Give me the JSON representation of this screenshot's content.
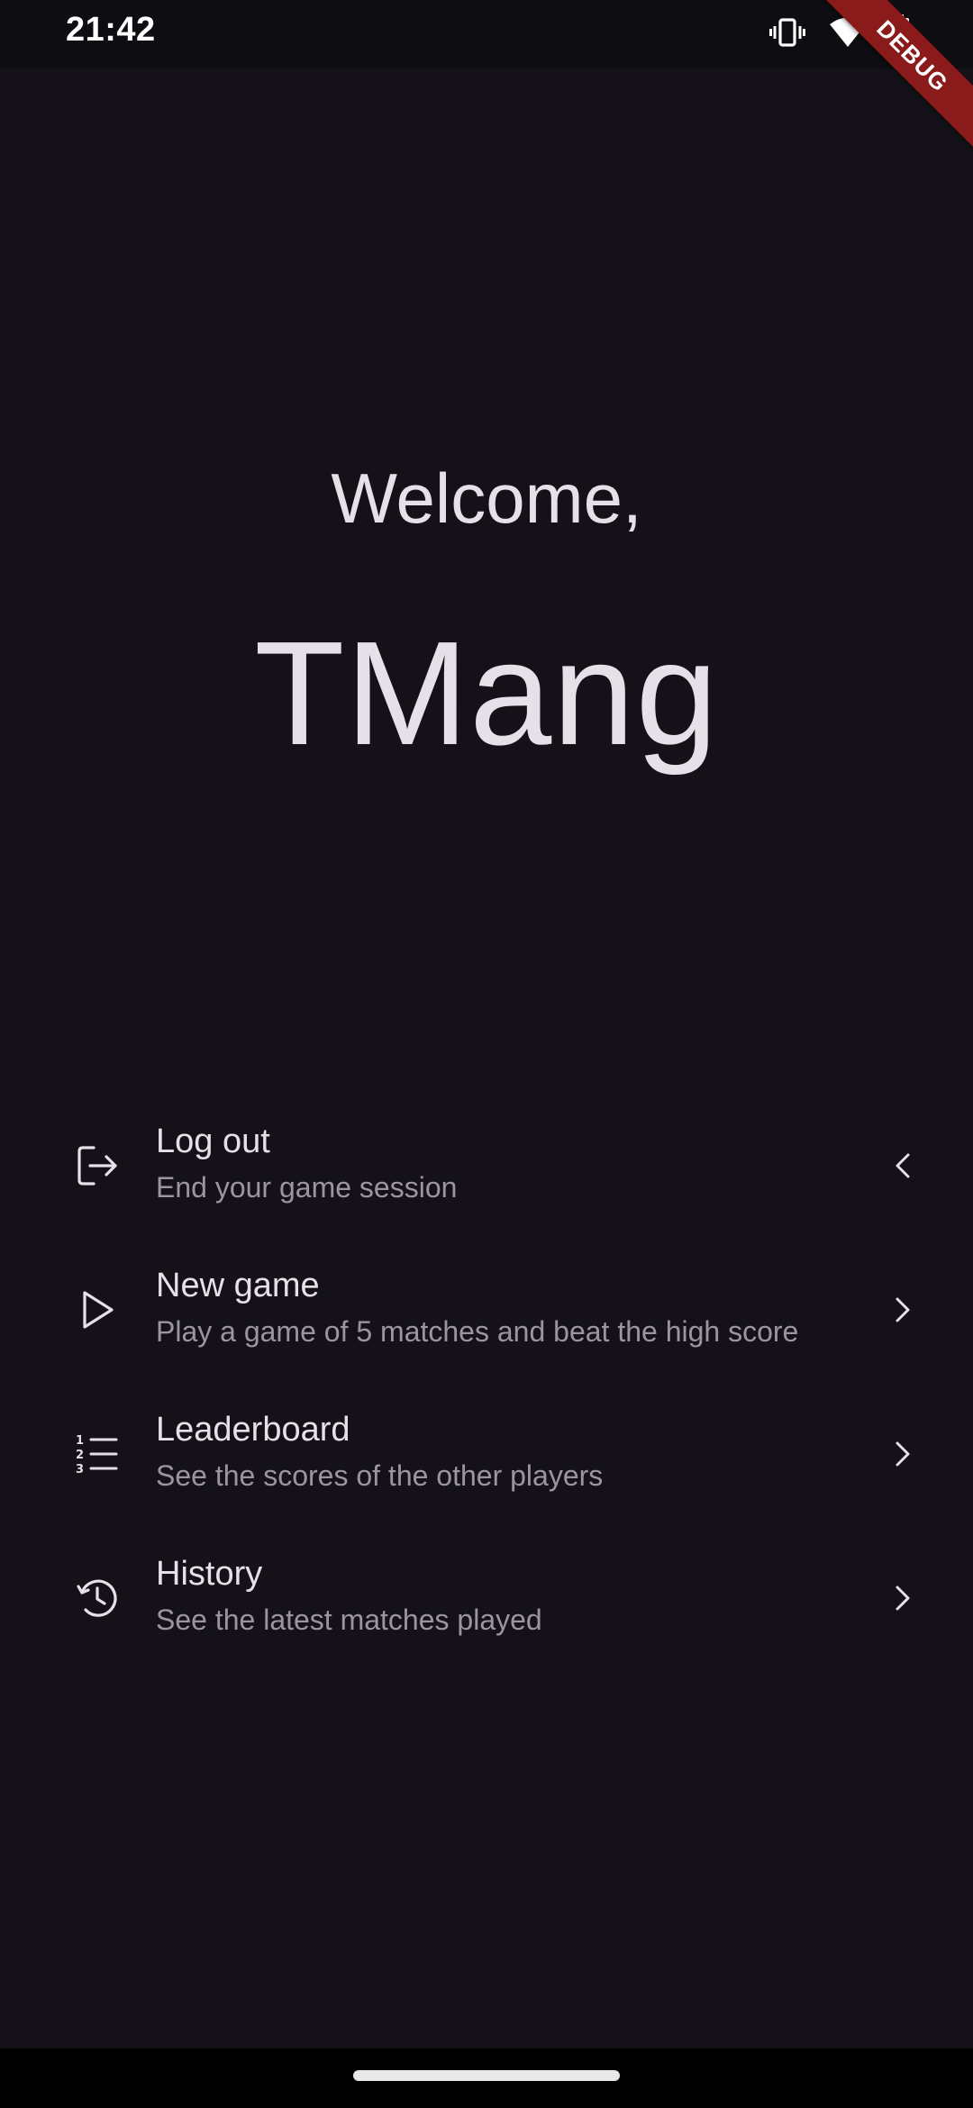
{
  "status_bar": {
    "time": "21:42",
    "icons": [
      "vibrate-icon",
      "wifi-icon",
      "battery-charging-icon"
    ]
  },
  "debug_banner": {
    "label": "DEBUG",
    "color": "#8b1a1a"
  },
  "header": {
    "welcome": "Welcome,",
    "username": "TMang"
  },
  "menu": {
    "items": [
      {
        "title": "Log out",
        "subtitle": "End your game session",
        "icon": "logout-icon",
        "chevron": "chevron-left-icon"
      },
      {
        "title": "New game",
        "subtitle": "Play a game of 5 matches and beat the high score",
        "icon": "play-icon",
        "chevron": "chevron-right-icon"
      },
      {
        "title": "Leaderboard",
        "subtitle": "See the scores of the other players",
        "icon": "numbered-list-icon",
        "chevron": "chevron-right-icon"
      },
      {
        "title": "History",
        "subtitle": "See the latest matches played",
        "icon": "history-icon",
        "chevron": "chevron-right-icon"
      }
    ]
  },
  "colors": {
    "background": "#141218",
    "text_primary": "#e6e0e9",
    "text_secondary": "#9a95a1"
  }
}
